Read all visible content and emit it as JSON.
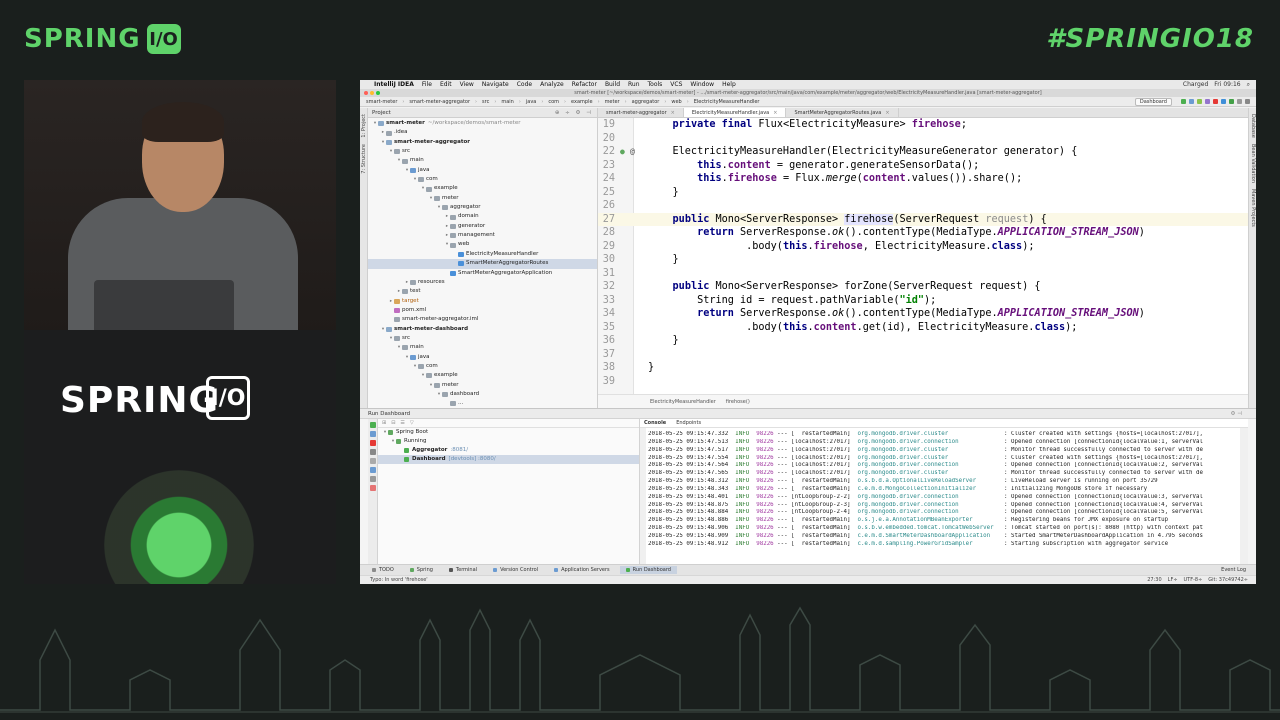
{
  "event": {
    "logo_text": "SPRING",
    "logo_badge": "I/O",
    "hashtag": "#SPRINGIO18",
    "podium_text": "SPRING",
    "podium_badge": "I/O"
  },
  "ide": {
    "menubar": {
      "app": "IntelliJ IDEA",
      "items": [
        "File",
        "Edit",
        "View",
        "Navigate",
        "Code",
        "Analyze",
        "Refactor",
        "Build",
        "Run",
        "Tools",
        "VCS",
        "Window",
        "Help"
      ],
      "battery": "Charged",
      "clock": "Fri 09:16"
    },
    "window_title": "smart-meter [~/workspace/demos/smart-meter] - .../smart-meter-aggregator/src/main/java/com/example/meter/aggregator/web/ElectricityMeasureHandler.java [smart-meter-aggregator]",
    "breadcrumbs": [
      "smart-meter",
      "smart-meter-aggregator",
      "src",
      "main",
      "java",
      "com",
      "example",
      "meter",
      "aggregator",
      "web",
      "ElectricityMeasureHandler"
    ],
    "run_config": "Dashboard",
    "project_panel": {
      "title": "Project",
      "tree": [
        {
          "label": "smart-meter",
          "hint": "~/workspace/demos/smart-meter",
          "indent": 0,
          "arrow": "▾",
          "color": "#8aa9c9"
        },
        {
          "label": ".idea",
          "indent": 1,
          "arrow": "▸",
          "color": "#9aa4ae"
        },
        {
          "label": "smart-meter-aggregator",
          "indent": 1,
          "arrow": "▾",
          "color": "#8aa9c9"
        },
        {
          "label": "src",
          "indent": 2,
          "arrow": "▾",
          "color": "#9aa4ae"
        },
        {
          "label": "main",
          "indent": 3,
          "arrow": "▾",
          "color": "#9aa4ae"
        },
        {
          "label": "java",
          "indent": 4,
          "arrow": "▾",
          "color": "#6b9bd1"
        },
        {
          "label": "com",
          "indent": 5,
          "arrow": "▾",
          "color": "#9aa4ae"
        },
        {
          "label": "example",
          "indent": 6,
          "arrow": "▾",
          "color": "#9aa4ae"
        },
        {
          "label": "meter",
          "indent": 7,
          "arrow": "▾",
          "color": "#9aa4ae"
        },
        {
          "label": "aggregator",
          "indent": 8,
          "arrow": "▾",
          "color": "#9aa4ae"
        },
        {
          "label": "domain",
          "indent": 9,
          "arrow": "▸",
          "color": "#9aa4ae"
        },
        {
          "label": "generator",
          "indent": 9,
          "arrow": "▸",
          "color": "#9aa4ae"
        },
        {
          "label": "management",
          "indent": 9,
          "arrow": "▸",
          "color": "#9aa4ae"
        },
        {
          "label": "web",
          "indent": 9,
          "arrow": "▾",
          "color": "#9aa4ae"
        },
        {
          "label": "ElectricityMeasureHandler",
          "indent": 10,
          "arrow": "",
          "color": "#4a90d9"
        },
        {
          "label": "SmartMeterAggregatorRoutes",
          "indent": 10,
          "arrow": "",
          "color": "#4a90d9",
          "selected": true
        },
        {
          "label": "SmartMeterAggregatorApplication",
          "indent": 9,
          "arrow": "",
          "color": "#4a90d9"
        },
        {
          "label": "resources",
          "indent": 4,
          "arrow": "▸",
          "color": "#9aa4ae"
        },
        {
          "label": "test",
          "indent": 3,
          "arrow": "▸",
          "color": "#9aa4ae"
        },
        {
          "label": "target",
          "indent": 2,
          "arrow": "▸",
          "color": "#d9a65a",
          "orange": true
        },
        {
          "label": "pom.xml",
          "indent": 2,
          "arrow": "",
          "color": "#c06cc0"
        },
        {
          "label": "smart-meter-aggregator.iml",
          "indent": 2,
          "arrow": "",
          "color": "#9aa4ae"
        },
        {
          "label": "smart-meter-dashboard",
          "indent": 1,
          "arrow": "▾",
          "color": "#8aa9c9"
        },
        {
          "label": "src",
          "indent": 2,
          "arrow": "▾",
          "color": "#9aa4ae"
        },
        {
          "label": "main",
          "indent": 3,
          "arrow": "▾",
          "color": "#9aa4ae"
        },
        {
          "label": "java",
          "indent": 4,
          "arrow": "▾",
          "color": "#6b9bd1"
        },
        {
          "label": "com",
          "indent": 5,
          "arrow": "▾",
          "color": "#9aa4ae"
        },
        {
          "label": "example",
          "indent": 6,
          "arrow": "▾",
          "color": "#9aa4ae"
        },
        {
          "label": "meter",
          "indent": 7,
          "arrow": "▾",
          "color": "#9aa4ae"
        },
        {
          "label": "dashboard",
          "indent": 8,
          "arrow": "▾",
          "color": "#9aa4ae"
        },
        {
          "label": "...",
          "indent": 9,
          "arrow": "",
          "color": "#9aa4ae"
        }
      ]
    },
    "editor_tabs": [
      {
        "label": "smart-meter-aggregator",
        "active": false
      },
      {
        "label": "ElectricityMeasureHandler.java",
        "active": true
      },
      {
        "label": "SmartMeterAggregatorRoutes.java",
        "active": false
      }
    ],
    "code_lines": [
      {
        "n": "19",
        "html": "    <span class=\"kw\">private final</span> Flux&lt;ElectricityMeasure&gt; <span class=\"fld\">firehose</span>;"
      },
      {
        "n": "20",
        "html": ""
      },
      {
        "n": "22",
        "html": "    ElectricityMeasureHandler(ElectricityMeasureGenerator generator) {",
        "mark": true
      },
      {
        "n": "23",
        "html": "        <span class=\"kw\">this</span>.<span class=\"fld\">content</span> = generator.generateSensorData();"
      },
      {
        "n": "24",
        "html": "        <span class=\"kw\">this</span>.<span class=\"fld\">firehose</span> = Flux.<span class=\"it\">merge</span>(<span class=\"fld\">content</span>.values()).share();"
      },
      {
        "n": "25",
        "html": "    }"
      },
      {
        "n": "26",
        "html": ""
      },
      {
        "n": "27",
        "html": "    <span class=\"kw\">public</span> Mono&lt;ServerResponse&gt; <span class=\"hl\">firehose</span>(ServerRequest <span class=\"par\">request</span>) {",
        "current": true
      },
      {
        "n": "28",
        "html": "        <span class=\"kw\">return</span> ServerResponse.<span class=\"it\">ok</span>().contentType(MediaType.<span class=\"cst\">APPLICATION_STREAM_JSON</span>)"
      },
      {
        "n": "29",
        "html": "                .body(<span class=\"kw\">this</span>.<span class=\"fld\">firehose</span>, ElectricityMeasure.<span class=\"kw\">class</span>);"
      },
      {
        "n": "30",
        "html": "    }"
      },
      {
        "n": "31",
        "html": ""
      },
      {
        "n": "32",
        "html": "    <span class=\"kw\">public</span> Mono&lt;ServerResponse&gt; forZone(ServerRequest request) {"
      },
      {
        "n": "33",
        "html": "        String id = request.pathVariable(<span class=\"str\">\"id\"</span>);"
      },
      {
        "n": "34",
        "html": "        <span class=\"kw\">return</span> ServerResponse.<span class=\"it\">ok</span>().contentType(MediaType.<span class=\"cst\">APPLICATION_STREAM_JSON</span>)"
      },
      {
        "n": "35",
        "html": "                .body(<span class=\"kw\">this</span>.<span class=\"fld\">content</span>.get(id), ElectricityMeasure.<span class=\"kw\">class</span>);"
      },
      {
        "n": "36",
        "html": "    }"
      },
      {
        "n": "37",
        "html": ""
      },
      {
        "n": "38",
        "html": "}"
      },
      {
        "n": "39",
        "html": ""
      }
    ],
    "editor_footer": [
      "ElectricityMeasureHandler",
      "firehose()"
    ],
    "run_dashboard": {
      "title": "Run Dashboard",
      "tree": [
        {
          "label": "Spring Boot",
          "indent": 0,
          "arrow": "▾",
          "color": "#5fa85f"
        },
        {
          "label": "Running",
          "indent": 1,
          "arrow": "▾",
          "color": "#5fa85f"
        },
        {
          "label": "Aggregator",
          "port": ":8081/",
          "indent": 2,
          "arrow": "",
          "color": "#4caf50",
          "bold": true
        },
        {
          "label": "Dashboard",
          "port": "[devtools] :8080/",
          "indent": 2,
          "arrow": "",
          "color": "#4caf50",
          "bold": true,
          "selected": true
        }
      ],
      "console_tabs": [
        "Console",
        "Endpoints"
      ],
      "log": [
        {
          "ts": "2018-05-25 09:15:47.332",
          "lvl": "INFO",
          "pid": "98226",
          "thread": "[  restartedMain]",
          "logger": "org.mongodb.driver.cluster              ",
          "msg": ": Cluster created with settings {hosts=[localhost:27017],"
        },
        {
          "ts": "2018-05-25 09:15:47.513",
          "lvl": "INFO",
          "pid": "98226",
          "thread": "[localhost:27017]",
          "logger": "org.mongodb.driver.connection           ",
          "msg": ": Opened connection [connectionId{localValue:1, serverVal"
        },
        {
          "ts": "2018-05-25 09:15:47.517",
          "lvl": "INFO",
          "pid": "98226",
          "thread": "[localhost:27017]",
          "logger": "org.mongodb.driver.cluster              ",
          "msg": ": Monitor thread successfully connected to server with de"
        },
        {
          "ts": "2018-05-25 09:15:47.554",
          "lvl": "INFO",
          "pid": "98226",
          "thread": "[localhost:27017]",
          "logger": "org.mongodb.driver.cluster              ",
          "msg": ": Cluster created with settings {hosts=[localhost:27017],"
        },
        {
          "ts": "2018-05-25 09:15:47.564",
          "lvl": "INFO",
          "pid": "98226",
          "thread": "[localhost:27017]",
          "logger": "org.mongodb.driver.connection           ",
          "msg": ": Opened connection [connectionId{localValue:2, serverVal"
        },
        {
          "ts": "2018-05-25 09:15:47.565",
          "lvl": "INFO",
          "pid": "98226",
          "thread": "[localhost:27017]",
          "logger": "org.mongodb.driver.cluster              ",
          "msg": ": Monitor thread successfully connected to server with de"
        },
        {
          "ts": "2018-05-25 09:15:48.312",
          "lvl": "INFO",
          "pid": "98226",
          "thread": "[  restartedMain]",
          "logger": "o.s.b.d.a.OptionalLiveReloadServer      ",
          "msg": ": LiveReload server is running on port 35729"
        },
        {
          "ts": "2018-05-25 09:15:48.343",
          "lvl": "INFO",
          "pid": "98226",
          "thread": "[  restartedMain]",
          "logger": "c.e.m.d.MongoCollectionInitializer      ",
          "msg": ": Initializing MongoDB store if necessary"
        },
        {
          "ts": "2018-05-25 09:15:48.401",
          "lvl": "INFO",
          "pid": "98226",
          "thread": "[ntLoopGroup-2-2]",
          "logger": "org.mongodb.driver.connection           ",
          "msg": ": Opened connection [connectionId{localValue:3, serverVal"
        },
        {
          "ts": "2018-05-25 09:15:48.875",
          "lvl": "INFO",
          "pid": "98226",
          "thread": "[ntLoopGroup-2-3]",
          "logger": "org.mongodb.driver.connection           ",
          "msg": ": Opened connection [connectionId{localValue:4, serverVal"
        },
        {
          "ts": "2018-05-25 09:15:48.884",
          "lvl": "INFO",
          "pid": "98226",
          "thread": "[ntLoopGroup-2-4]",
          "logger": "org.mongodb.driver.connection           ",
          "msg": ": Opened connection [connectionId{localValue:5, serverVal"
        },
        {
          "ts": "2018-05-25 09:15:48.886",
          "lvl": "INFO",
          "pid": "98226",
          "thread": "[  restartedMain]",
          "logger": "o.s.j.e.a.AnnotationMBeanExporter       ",
          "msg": ": Registering beans for JMX exposure on startup"
        },
        {
          "ts": "2018-05-25 09:15:48.906",
          "lvl": "INFO",
          "pid": "98226",
          "thread": "[  restartedMain]",
          "logger": "o.s.b.w.embedded.tomcat.TomcatWebServer ",
          "msg": ": Tomcat started on port(s): 8080 (http) with context pat"
        },
        {
          "ts": "2018-05-25 09:15:48.909",
          "lvl": "INFO",
          "pid": "98226",
          "thread": "[  restartedMain]",
          "logger": "c.e.m.d.SmartMeterDashboardApplication  ",
          "msg": ": Started SmartMeterDashboardApplication in 4.795 seconds"
        },
        {
          "ts": "2018-05-25 09:15:48.912",
          "lvl": "INFO",
          "pid": "98226",
          "thread": "[  restartedMain]",
          "logger": "c.e.m.d.sampling.PowerGridSampler       ",
          "msg": ": Starting subscription with aggregator service"
        }
      ]
    },
    "bottom_tabs": [
      {
        "label": "TODO",
        "color": "#8a8a8a"
      },
      {
        "label": "Spring",
        "color": "#5fa85f"
      },
      {
        "label": "Terminal",
        "color": "#555555"
      },
      {
        "label": "Version Control",
        "color": "#6b9bd1"
      },
      {
        "label": "Application Servers",
        "color": "#6b9bd1"
      },
      {
        "label": "Run Dashboard",
        "color": "#4caf50",
        "active": true
      }
    ],
    "event_log": "Event Log",
    "status_left": "Typo: In word 'firehose'",
    "status_right": [
      "27:30",
      "LF÷",
      "UTF-8÷",
      "Git: 37c49742÷"
    ]
  }
}
